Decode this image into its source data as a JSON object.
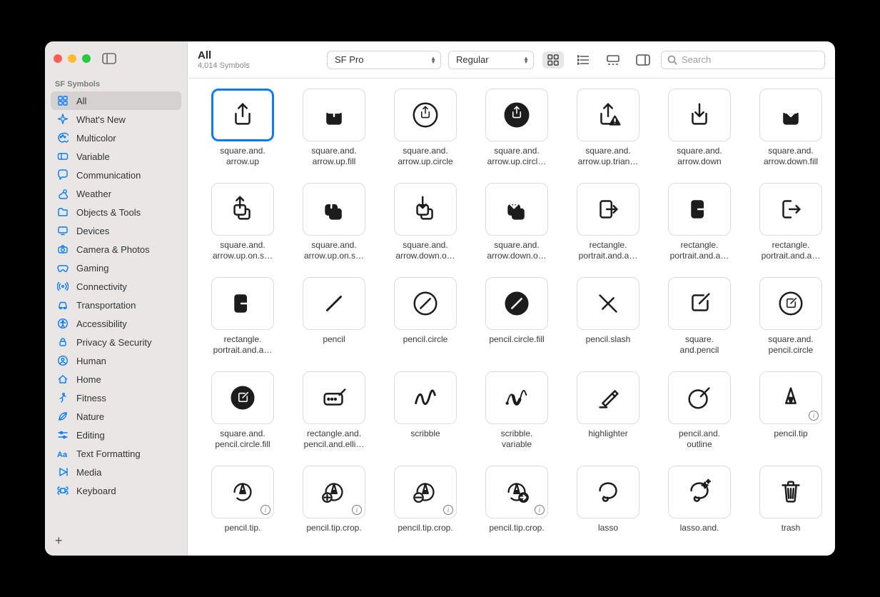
{
  "app": "SF Symbols",
  "sidebar": {
    "heading": "SF Symbols",
    "items": [
      {
        "label": "All",
        "icon": "grid-2x2-icon",
        "selected": true
      },
      {
        "label": "What's New",
        "icon": "sparkle-icon"
      },
      {
        "label": "Multicolor",
        "icon": "palette-icon"
      },
      {
        "label": "Variable",
        "icon": "slider-icon"
      },
      {
        "label": "Communication",
        "icon": "bubble-icon"
      },
      {
        "label": "Weather",
        "icon": "cloud-sun-icon"
      },
      {
        "label": "Objects & Tools",
        "icon": "folder-icon"
      },
      {
        "label": "Devices",
        "icon": "display-icon"
      },
      {
        "label": "Camera & Photos",
        "icon": "camera-icon"
      },
      {
        "label": "Gaming",
        "icon": "gamecontroller-icon"
      },
      {
        "label": "Connectivity",
        "icon": "antenna-icon"
      },
      {
        "label": "Transportation",
        "icon": "car-icon"
      },
      {
        "label": "Accessibility",
        "icon": "accessibility-icon"
      },
      {
        "label": "Privacy & Security",
        "icon": "lock-icon"
      },
      {
        "label": "Human",
        "icon": "person-icon"
      },
      {
        "label": "Home",
        "icon": "house-icon"
      },
      {
        "label": "Fitness",
        "icon": "figure-run-icon"
      },
      {
        "label": "Nature",
        "icon": "leaf-icon"
      },
      {
        "label": "Editing",
        "icon": "slider-horizontal-icon"
      },
      {
        "label": "Text Formatting",
        "icon": "textformat-icon"
      },
      {
        "label": "Media",
        "icon": "play-icon"
      },
      {
        "label": "Keyboard",
        "icon": "command-icon"
      }
    ],
    "add_label": "+"
  },
  "header": {
    "title": "All",
    "subtitle": "4,014 Symbols",
    "font_select": "SF Pro",
    "weight_select": "Regular"
  },
  "search": {
    "placeholder": "Search"
  },
  "symbols": [
    {
      "name": "square.and.arrow.up",
      "label": "square.and.\narrow.up",
      "selected": true
    },
    {
      "name": "square.and.arrow.up.fill",
      "label": "square.and.\narrow.up.fill"
    },
    {
      "name": "square.and.arrow.up.circle",
      "label": "square.and.\narrow.up.circle"
    },
    {
      "name": "square.and.arrow.up.circle.fill",
      "label": "square.and.\narrow.up.circl…"
    },
    {
      "name": "square.and.arrow.up.trianglebadge.exclamationmark",
      "label": "square.and.\narrow.up.trian…"
    },
    {
      "name": "square.and.arrow.down",
      "label": "square.and.\narrow.down"
    },
    {
      "name": "square.and.arrow.down.fill",
      "label": "square.and.\narrow.down.fill"
    },
    {
      "name": "square.and.arrow.up.on.square",
      "label": "square.and.\narrow.up.on.s…"
    },
    {
      "name": "square.and.arrow.up.on.square.fill",
      "label": "square.and.\narrow.up.on.s…"
    },
    {
      "name": "square.and.arrow.down.on.square",
      "label": "square.and.\narrow.down.o…"
    },
    {
      "name": "square.and.arrow.down.on.square.fill",
      "label": "square.and.\narrow.down.o…"
    },
    {
      "name": "rectangle.portrait.and.arrow.right",
      "label": "rectangle.\nportrait.and.a…"
    },
    {
      "name": "rectangle.portrait.and.arrow.right.fill",
      "label": "rectangle.\nportrait.and.a…"
    },
    {
      "name": "rectangle.portrait.and.arrow.forward",
      "label": "rectangle.\nportrait.and.a…"
    },
    {
      "name": "rectangle.portrait.and.arrow.forward.fill",
      "label": "rectangle.\nportrait.and.a…"
    },
    {
      "name": "pencil",
      "label": "pencil"
    },
    {
      "name": "pencil.circle",
      "label": "pencil.circle"
    },
    {
      "name": "pencil.circle.fill",
      "label": "pencil.circle.fill"
    },
    {
      "name": "pencil.slash",
      "label": "pencil.slash"
    },
    {
      "name": "square.and.pencil",
      "label": "square.\nand.pencil"
    },
    {
      "name": "square.and.pencil.circle",
      "label": "square.and.\npencil.circle"
    },
    {
      "name": "square.and.pencil.circle.fill",
      "label": "square.and.\npencil.circle.fill"
    },
    {
      "name": "rectangle.and.pencil.and.ellipsis",
      "label": "rectangle.and.\npencil.and.elli…"
    },
    {
      "name": "scribble",
      "label": "scribble"
    },
    {
      "name": "scribble.variable",
      "label": "scribble.\nvariable"
    },
    {
      "name": "highlighter",
      "label": "highlighter"
    },
    {
      "name": "pencil.and.outline",
      "label": "pencil.and.\noutline"
    },
    {
      "name": "pencil.tip",
      "label": "pencil.tip",
      "info": true
    },
    {
      "name": "pencil.tip.crop.circle",
      "label": "pencil.tip.",
      "info": true
    },
    {
      "name": "pencil.tip.crop.circle.badge.plus",
      "label": "pencil.tip.crop.",
      "info": true
    },
    {
      "name": "pencil.tip.crop.circle.badge.minus",
      "label": "pencil.tip.crop.",
      "info": true
    },
    {
      "name": "pencil.tip.crop.circle.badge.arrow.forward",
      "label": "pencil.tip.crop.",
      "info": true
    },
    {
      "name": "lasso",
      "label": "lasso"
    },
    {
      "name": "lasso.and.sparkles",
      "label": "lasso.and."
    },
    {
      "name": "trash",
      "label": "trash"
    }
  ]
}
